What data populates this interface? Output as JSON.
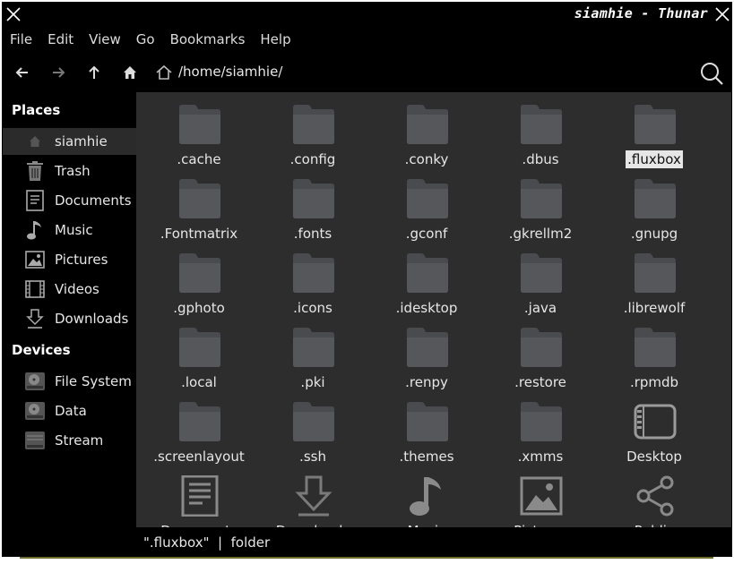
{
  "window": {
    "title": "siamhie - Thunar"
  },
  "menu": [
    "File",
    "Edit",
    "View",
    "Go",
    "Bookmarks",
    "Help"
  ],
  "toolbar": {
    "icons": [
      "back-arrow-icon",
      "forward-arrow-icon",
      "up-arrow-icon",
      "home-icon",
      "search-icon"
    ],
    "path": "/home/siamhie/"
  },
  "sidebar": {
    "places_heading": "Places",
    "places": [
      {
        "label": "siamhie",
        "icon": "home-icon",
        "selected": true
      },
      {
        "label": "Trash",
        "icon": "trash-icon"
      },
      {
        "label": "Documents",
        "icon": "documents-icon"
      },
      {
        "label": "Music",
        "icon": "music-icon"
      },
      {
        "label": "Pictures",
        "icon": "pictures-icon"
      },
      {
        "label": "Videos",
        "icon": "videos-icon"
      },
      {
        "label": "Downloads",
        "icon": "downloads-icon"
      }
    ],
    "devices_heading": "Devices",
    "devices": [
      {
        "label": "File System",
        "icon": "drive-icon"
      },
      {
        "label": "Data",
        "icon": "drive-icon"
      },
      {
        "label": "Stream",
        "icon": "drive-icon"
      }
    ]
  },
  "files": [
    {
      "name": ".cache",
      "icon": "folder-icon"
    },
    {
      "name": ".config",
      "icon": "folder-icon"
    },
    {
      "name": ".conky",
      "icon": "folder-icon"
    },
    {
      "name": ".dbus",
      "icon": "folder-icon"
    },
    {
      "name": ".fluxbox",
      "icon": "folder-icon",
      "selected": true
    },
    {
      "name": ".Fontmatrix",
      "icon": "folder-icon"
    },
    {
      "name": ".fonts",
      "icon": "folder-icon"
    },
    {
      "name": ".gconf",
      "icon": "folder-icon"
    },
    {
      "name": ".gkrellm2",
      "icon": "folder-icon"
    },
    {
      "name": ".gnupg",
      "icon": "folder-icon"
    },
    {
      "name": ".gphoto",
      "icon": "folder-icon"
    },
    {
      "name": ".icons",
      "icon": "folder-icon"
    },
    {
      "name": ".idesktop",
      "icon": "folder-icon"
    },
    {
      "name": ".java",
      "icon": "folder-icon"
    },
    {
      "name": ".librewolf",
      "icon": "folder-icon"
    },
    {
      "name": ".local",
      "icon": "folder-icon"
    },
    {
      "name": ".pki",
      "icon": "folder-icon"
    },
    {
      "name": ".renpy",
      "icon": "folder-icon"
    },
    {
      "name": ".restore",
      "icon": "folder-icon"
    },
    {
      "name": ".rpmdb",
      "icon": "folder-icon"
    },
    {
      "name": ".screenlayout",
      "icon": "folder-icon"
    },
    {
      "name": ".ssh",
      "icon": "folder-icon"
    },
    {
      "name": ".themes",
      "icon": "folder-icon"
    },
    {
      "name": ".xmms",
      "icon": "folder-icon"
    },
    {
      "name": "Desktop",
      "icon": "desktop-icon"
    },
    {
      "name": "Documents",
      "icon": "documents-icon"
    },
    {
      "name": "Downloads",
      "icon": "downloads-icon"
    },
    {
      "name": "Music",
      "icon": "music-icon"
    },
    {
      "name": "Pictures",
      "icon": "pictures-icon"
    },
    {
      "name": "Public",
      "icon": "share-icon"
    }
  ],
  "status": "\".fluxbox\"  |  folder",
  "colors": {
    "background": "#000000",
    "main_view": "#2d2d2d",
    "folder": "#4a4b4e",
    "text": "#e6e6e6",
    "selection": "#e6e6e6"
  }
}
